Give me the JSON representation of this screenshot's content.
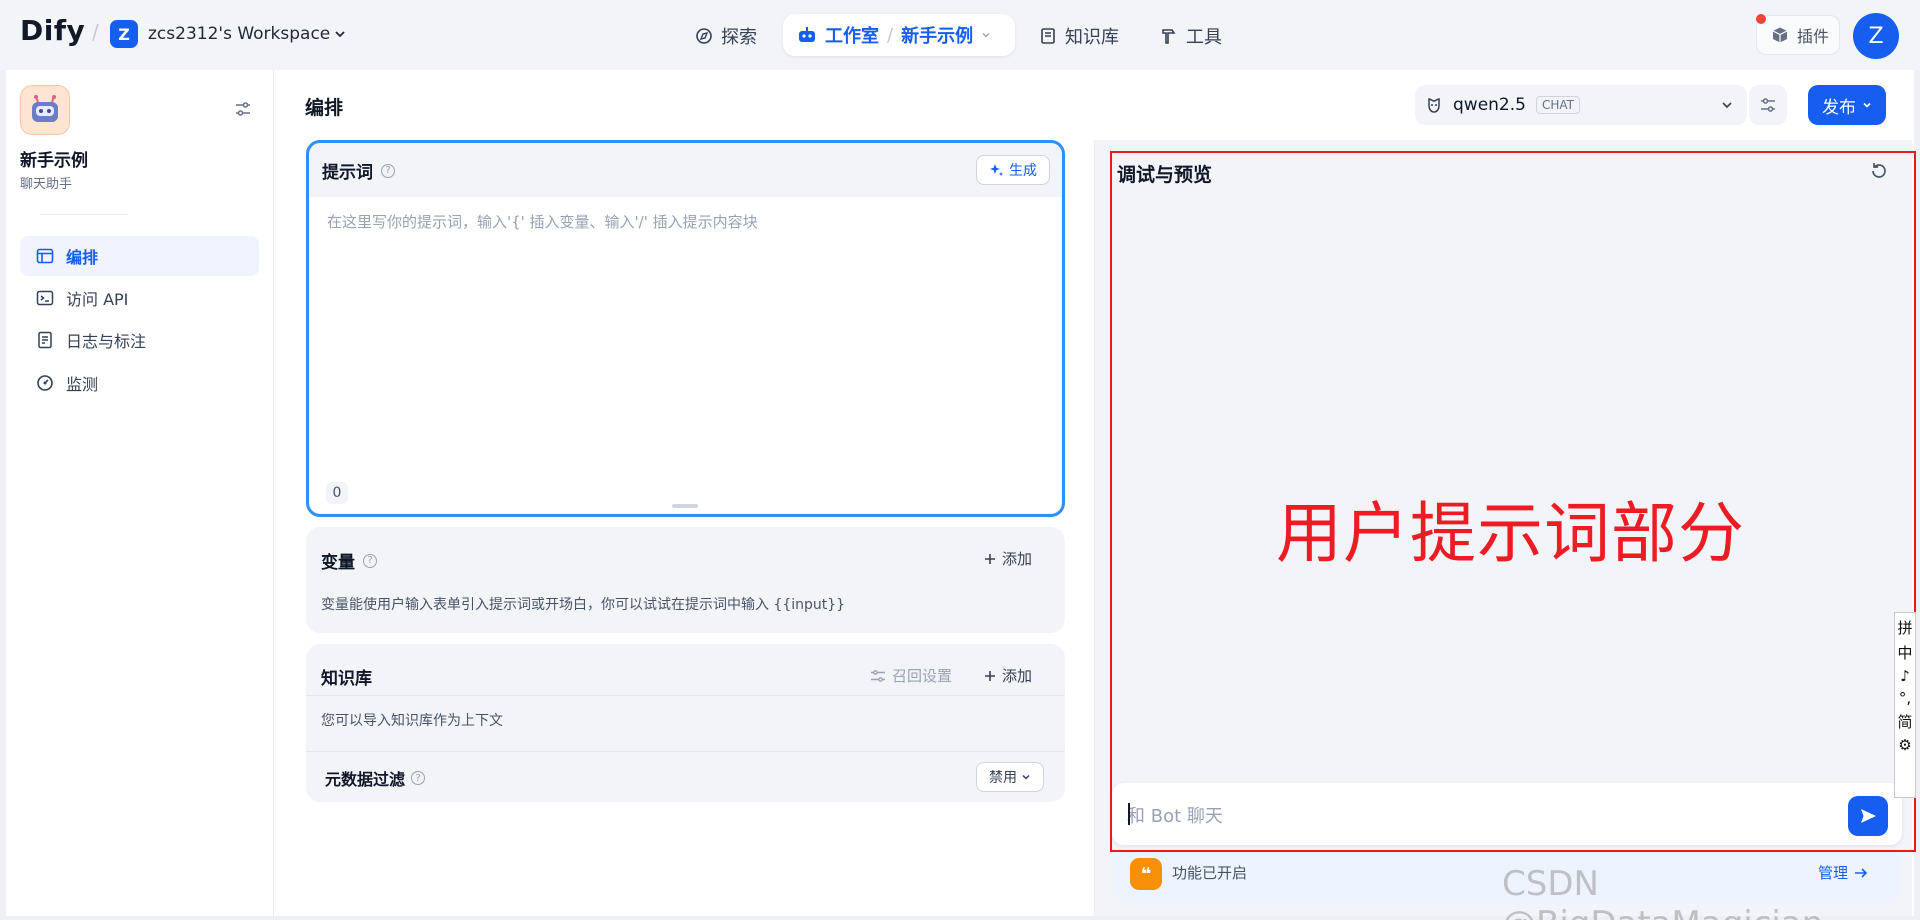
{
  "header": {
    "logo": "Dify",
    "workspace_initial": "Z",
    "workspace_name": "zcs2312's Workspace",
    "nav": {
      "explore": "探索",
      "studio": "工作室",
      "current_app": "新手示例",
      "knowledge": "知识库",
      "tools": "工具"
    },
    "plugins": "插件",
    "user_initial": "Z"
  },
  "sidebar": {
    "app_name": "新手示例",
    "app_type": "聊天助手",
    "items": [
      {
        "label": "编排",
        "icon": "layout-icon",
        "active": true
      },
      {
        "label": "访问 API",
        "icon": "terminal-icon",
        "active": false
      },
      {
        "label": "日志与标注",
        "icon": "log-icon",
        "active": false
      },
      {
        "label": "监测",
        "icon": "gauge-icon",
        "active": false
      }
    ]
  },
  "main": {
    "title": "编排",
    "model": {
      "name": "qwen2.5",
      "badge": "CHAT"
    },
    "publish": "发布",
    "prompt": {
      "title": "提示词",
      "generate": "生成",
      "placeholder": "在这里写你的提示词，输入'{' 插入变量、输入'/' 插入提示内容块",
      "count": "0"
    },
    "variables": {
      "title": "变量",
      "add": "添加",
      "description": "变量能使用户输入表单引入提示词或开场白，你可以试试在提示词中输入 {{input}}"
    },
    "knowledge": {
      "title": "知识库",
      "recall_settings": "召回设置",
      "add": "添加",
      "description": "您可以导入知识库作为上下文",
      "metadata_filter": "元数据过滤",
      "metadata_filter_value": "禁用"
    }
  },
  "debug": {
    "title": "调试与预览",
    "annotation": "用户提示词部分",
    "chat_placeholder": "和 Bot 聊天",
    "features_enabled": "功能已开启",
    "manage": "管理"
  },
  "watermark": "CSDN @BigDataMagician",
  "ime_toolbar": [
    "拼",
    "中",
    "♪",
    "°,",
    "简",
    "⚙"
  ],
  "colors": {
    "primary": "#155eef",
    "prompt_border": "#2e90fa",
    "annotation_red": "#ec1c24",
    "feature_icon": "#f79009"
  }
}
